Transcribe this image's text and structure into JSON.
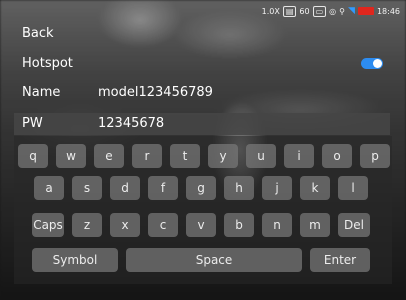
{
  "status": {
    "zoom": "1.0X",
    "fps": "60",
    "time": "18:46"
  },
  "menu": {
    "back_label": "Back",
    "hotspot_label": "Hotspot",
    "hotspot_enabled": true,
    "name_label": "Name",
    "name_value": "model123456789",
    "pw_label": "PW",
    "pw_value": "12345678"
  },
  "keyboard": {
    "row1": [
      "q",
      "w",
      "e",
      "r",
      "t",
      "y",
      "u",
      "i",
      "o",
      "p"
    ],
    "row2": [
      "a",
      "s",
      "d",
      "f",
      "g",
      "h",
      "j",
      "k",
      "l"
    ],
    "row3": [
      "Caps",
      "z",
      "x",
      "c",
      "v",
      "b",
      "n",
      "m",
      "Del"
    ],
    "row4": [
      "Symbol",
      "Space",
      "Enter"
    ]
  },
  "colors": {
    "toggle_on": "#2d8cf0",
    "wifi": "#2f9bff",
    "battery": "#e0261d"
  }
}
